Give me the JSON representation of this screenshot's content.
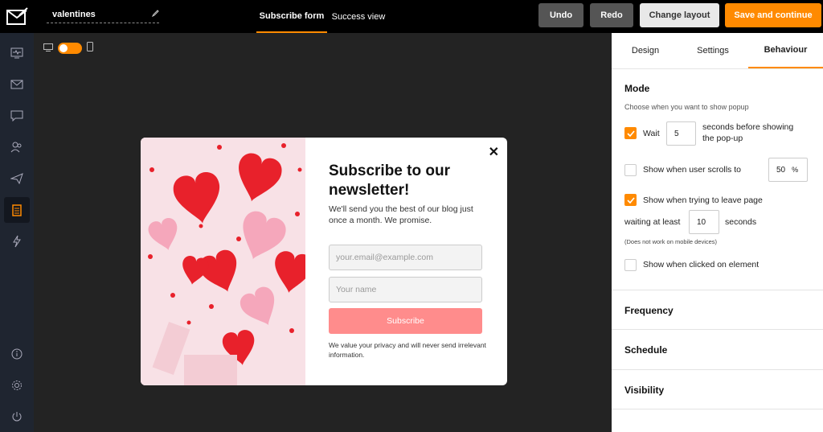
{
  "header": {
    "campaign_name": "valentines",
    "tabs": [
      {
        "label": "Subscribe form",
        "active": true
      },
      {
        "label": "Success view",
        "active": false
      }
    ],
    "undo_label": "Undo",
    "redo_label": "Redo",
    "change_layout_label": "Change layout",
    "save_label": "Save and continue"
  },
  "sidebar": {
    "icons": [
      "monitor-pulse-icon",
      "envelope-icon",
      "chat-icon",
      "users-icon",
      "paper-plane-icon",
      "clipboard-icon",
      "lightning-icon",
      "info-icon",
      "gear-icon",
      "power-icon"
    ],
    "active": "clipboard-icon"
  },
  "canvas": {
    "device_toggle": {
      "desktop": "desktop-icon",
      "mobile": "mobile-icon",
      "state": "desktop"
    }
  },
  "popup": {
    "close_glyph": "✕",
    "title": "Subscribe to our newsletter!",
    "description": "We'll send you the best of our blog just once a month. We promise.",
    "email_placeholder": "your.email@example.com",
    "name_placeholder": "Your name",
    "button_label": "Subscribe",
    "privacy_text": "We value your privacy and will never send irrelevant information."
  },
  "panel": {
    "tabs": [
      {
        "label": "Design",
        "active": false
      },
      {
        "label": "Settings",
        "active": false
      },
      {
        "label": "Behaviour",
        "active": true
      }
    ],
    "mode": {
      "title": "Mode",
      "subtitle": "Choose when you want to show popup",
      "wait": {
        "checked": true,
        "label": "Wait",
        "value": "5",
        "suffix": "seconds before showing the pop-up"
      },
      "scroll": {
        "checked": false,
        "label": "Show when user scrolls to",
        "value": "50",
        "unit": "%"
      },
      "leave": {
        "checked": true,
        "label": "Show when trying to leave page",
        "waiting_label": "waiting at least",
        "value": "10",
        "suffix": "seconds",
        "note": "(Does not work on mobile devices)"
      },
      "clicked": {
        "checked": false,
        "label": "Show when clicked on element"
      }
    },
    "sections": [
      "Frequency",
      "Schedule",
      "Visibility"
    ]
  },
  "colors": {
    "accent": "#ff8a00",
    "subscribe_button": "#ff8c8c",
    "sidebar_bg": "#1f2530",
    "canvas_bg": "#232323"
  }
}
